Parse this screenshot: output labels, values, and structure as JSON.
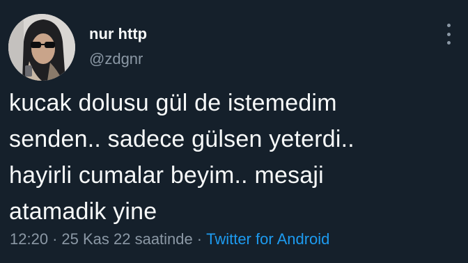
{
  "user": {
    "display_name": "nur http",
    "handle": "@zdgnr"
  },
  "tweet": {
    "text": "kucak dolusu gül de istemedim\nsenden.. sadece gülsen yeterdi..\nhayirli cumalar beyim.. mesaji\natamadik yine"
  },
  "meta": {
    "time": "12:20",
    "separator": "·",
    "date": "25 Kas 22 saatinde",
    "source": "Twitter for Android"
  },
  "icons": {
    "more": "more-vertical-icon",
    "avatar": "profile-photo"
  },
  "colors": {
    "background": "#15202b",
    "text_primary": "#f7f9f9",
    "text_secondary": "#8b98a5",
    "accent": "#1d9bf0"
  }
}
